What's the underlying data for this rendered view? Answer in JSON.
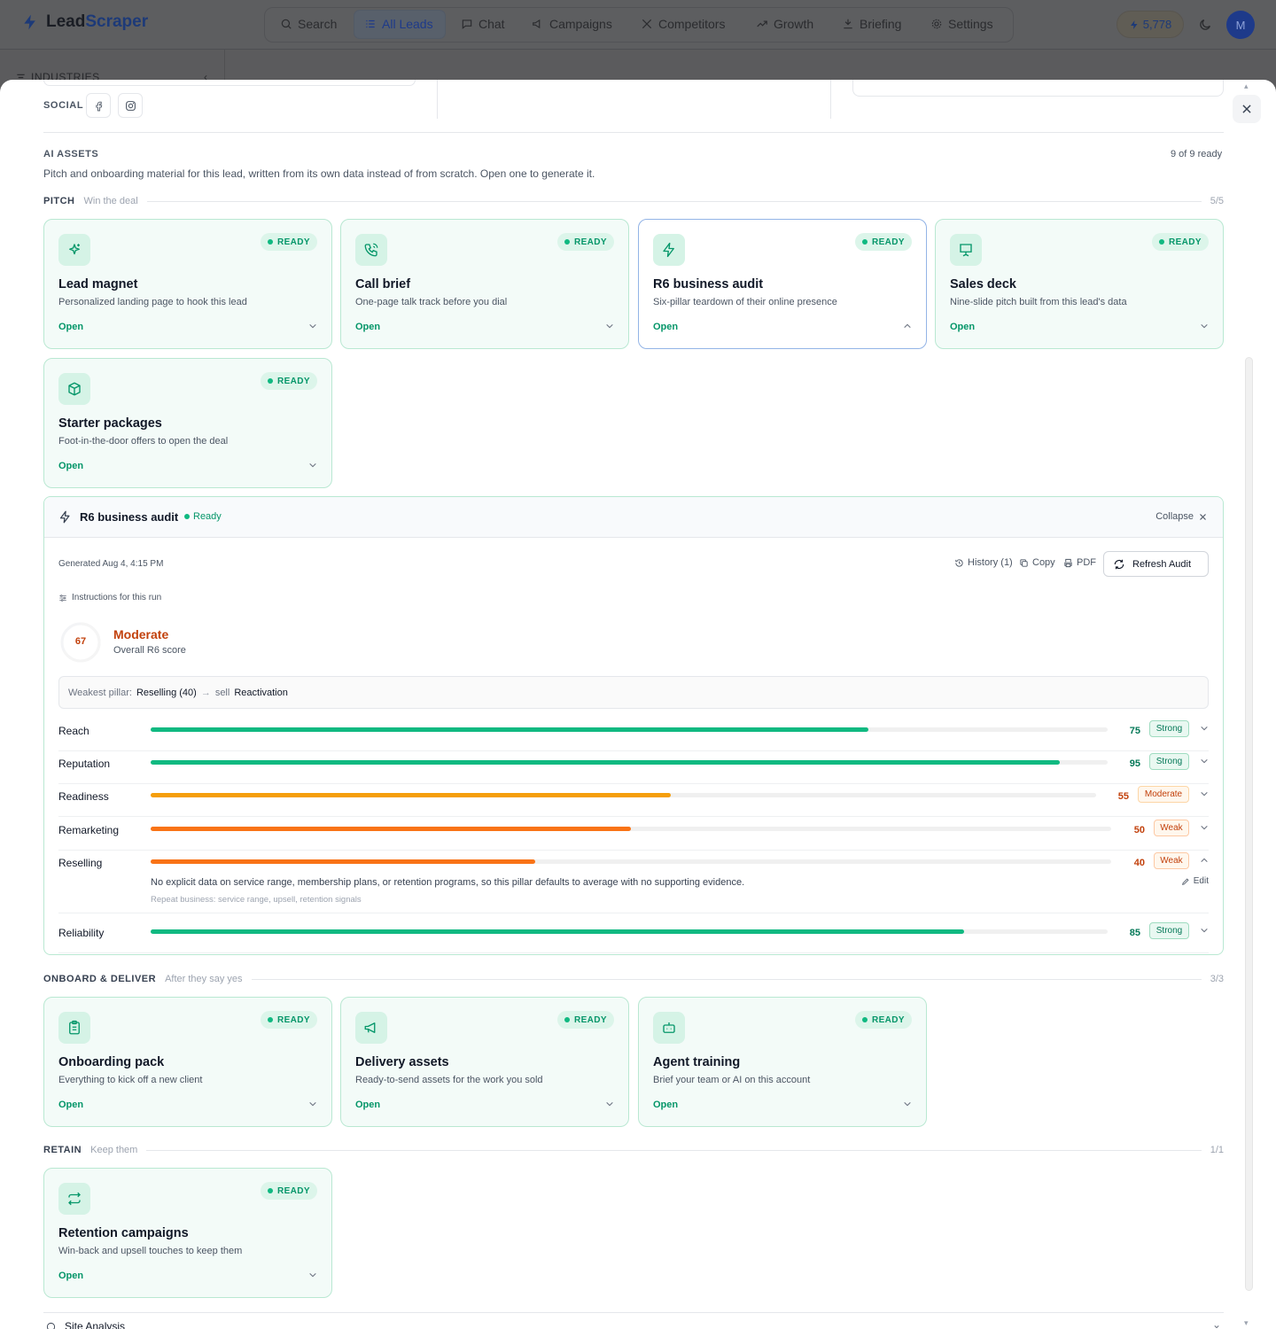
{
  "app": {
    "brand_first": "Lead",
    "brand_second": "Scraper",
    "nav": [
      "Search",
      "All Leads",
      "Chat",
      "Campaigns",
      "Competitors",
      "Growth",
      "Briefing",
      "Settings"
    ],
    "active_nav": "All Leads",
    "credits": "5,778",
    "avatar_initial": "M",
    "sidebar_heading": "INDUSTRIES"
  },
  "contact": {
    "social_label": "SOCIAL",
    "social_icons": [
      "facebook-icon",
      "instagram-icon"
    ]
  },
  "assets": {
    "title": "AI ASSETS",
    "ready_count": "9 of 9 ready",
    "description": "Pitch and onboarding material for this lead, written from its own data instead of from scratch. Open one to generate it.",
    "open_label": "Open",
    "ready_label": "READY",
    "groups": {
      "pitch": {
        "name": "PITCH",
        "sub": "Win the deal",
        "count": "5/5"
      },
      "onboard": {
        "name": "ONBOARD & DELIVER",
        "sub": "After they say yes",
        "count": "3/3"
      },
      "retain": {
        "name": "RETAIN",
        "sub": "Keep them",
        "count": "1/1"
      }
    },
    "cards": [
      {
        "title": "Lead magnet",
        "desc": "Personalized landing page to hook this lead",
        "icon": "sparkles-icon"
      },
      {
        "title": "Call brief",
        "desc": "One-page talk track before you dial",
        "icon": "phone-icon"
      },
      {
        "title": "R6 business audit",
        "desc": "Six-pillar teardown of their online presence",
        "icon": "lightning-icon"
      },
      {
        "title": "Sales deck",
        "desc": "Nine-slide pitch built from this lead's data",
        "icon": "presentation-icon"
      },
      {
        "title": "Starter packages",
        "desc": "Foot-in-the-door offers to open the deal",
        "icon": "package-icon"
      },
      {
        "title": "Onboarding pack",
        "desc": "Everything to kick off a new client",
        "icon": "clipboard-icon"
      },
      {
        "title": "Delivery assets",
        "desc": "Ready-to-send assets for the work you sold",
        "icon": "megaphone-icon"
      },
      {
        "title": "Agent training",
        "desc": "Brief your team or AI on this account",
        "icon": "bot-icon"
      },
      {
        "title": "Retention campaigns",
        "desc": "Win-back and upsell touches to keep them",
        "icon": "repeat-icon"
      }
    ]
  },
  "audit": {
    "title": "R6 business audit",
    "status": "Ready",
    "collapse_label": "Collapse",
    "generated": "Generated Aug 4, 4:15 PM",
    "history_label": "History (1)",
    "copy_label": "Copy",
    "pdf_label": "PDF",
    "refresh_label": "Refresh Audit",
    "instructions_label": "Instructions for this run",
    "overall_score": "67",
    "overall_level": "Moderate",
    "overall_caption": "Overall R6 score",
    "weakest_prefix": "Weakest pillar:",
    "weakest_pillar": "Reselling (40)",
    "weakest_arrow": "→",
    "weakest_sell": "sell",
    "weakest_product": "Reactivation",
    "pillars": [
      {
        "name": "Reach",
        "score": 75,
        "label": "Strong",
        "color": "#10b981"
      },
      {
        "name": "Reputation",
        "score": 95,
        "label": "Strong",
        "color": "#10b981"
      },
      {
        "name": "Readiness",
        "score": 55,
        "label": "Moderate",
        "color": "#f59e0b"
      },
      {
        "name": "Remarketing",
        "score": 50,
        "label": "Weak",
        "color": "#f97316"
      },
      {
        "name": "Reselling",
        "score": 40,
        "label": "Weak",
        "color": "#f97316"
      },
      {
        "name": "Reliability",
        "score": 85,
        "label": "Strong",
        "color": "#10b981"
      }
    ],
    "reselling_note": "No explicit data on service range, membership plans, or retention programs, so this pillar defaults to average with no supporting evidence.",
    "reselling_hint": "Repeat business: service range, upsell, retention signals",
    "edit_label": "Edit"
  },
  "site_analysis": {
    "label": "Site Analysis"
  }
}
